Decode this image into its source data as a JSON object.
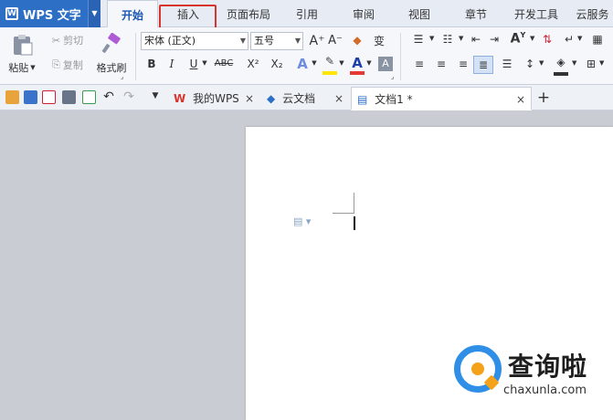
{
  "app": {
    "name": "WPS 文字",
    "logo_letter": "W"
  },
  "tabs": [
    {
      "label": "开始",
      "active": true
    },
    {
      "label": "插入",
      "highlighted": true
    },
    {
      "label": "页面布局"
    },
    {
      "label": "引用"
    },
    {
      "label": "审阅"
    },
    {
      "label": "视图"
    },
    {
      "label": "章节"
    },
    {
      "label": "开发工具"
    },
    {
      "label": "云服务"
    }
  ],
  "ribbon": {
    "paste": "粘贴",
    "cut": "剪切",
    "copy": "复制",
    "format_painter": "格式刷",
    "font_name": "宋体 (正文)",
    "font_size": "五号",
    "bold": "B",
    "italic": "I",
    "underline": "U",
    "strikethrough": "ABC",
    "superscript": "X²",
    "subscript": "X₂",
    "text_effect": "A",
    "font_color": "A",
    "grow_font": "A⁺",
    "shrink_font": "A⁻",
    "phonetic": "变"
  },
  "doc_tabs": [
    {
      "label": "我的WPS",
      "close": "×"
    },
    {
      "label": "云文档",
      "close": "×"
    },
    {
      "label": "文档1 *",
      "close": "×",
      "active": true
    }
  ],
  "new_tab": "+",
  "watermark": {
    "title": "查询啦",
    "url": "chaxunla.com"
  },
  "colors": {
    "accent": "#2e6fc6",
    "highlight_box": "#d9332e",
    "font_color_bar": "#e53935",
    "highlight_bar": "#ffe600"
  }
}
